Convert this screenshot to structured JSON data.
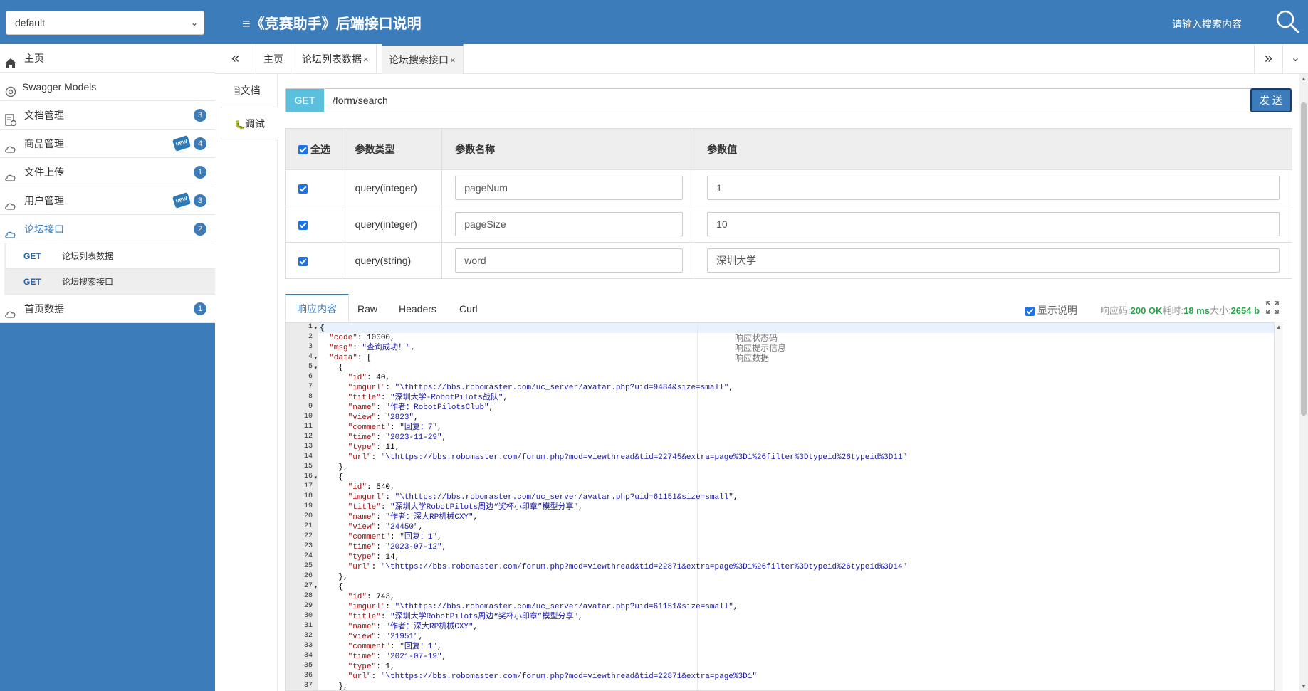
{
  "header": {
    "group_select": "default",
    "title": "≡《竞赛助手》后端接口说明",
    "search_hint": "请输入搜索内容"
  },
  "sidebar": {
    "items": [
      {
        "label": "主页",
        "icon": "home-icon"
      },
      {
        "label": "Swagger Models",
        "icon": "cube-icon"
      },
      {
        "label": "文档管理",
        "icon": "doc-settings-icon",
        "badge": "3"
      },
      {
        "label": "商品管理",
        "icon": "cloud-icon",
        "badge": "4",
        "new": "NEW"
      },
      {
        "label": "文件上传",
        "icon": "cloud-icon",
        "badge": "1"
      },
      {
        "label": "用户管理",
        "icon": "cloud-icon",
        "badge": "3",
        "new": "NEW"
      },
      {
        "label": "论坛接口",
        "icon": "cloud-icon",
        "badge": "2"
      },
      {
        "label": "首页数据",
        "icon": "cloud-icon",
        "badge": "1"
      }
    ],
    "sub_items": [
      {
        "method": "GET",
        "label": "论坛列表数据"
      },
      {
        "method": "GET",
        "label": "论坛搜索接口"
      }
    ]
  },
  "tabs": {
    "items": [
      {
        "label": "主页"
      },
      {
        "label": "论坛列表数据",
        "close": "×"
      },
      {
        "label": "论坛搜索接口",
        "close": "×"
      }
    ],
    "nav_left": "«",
    "nav_right": "»",
    "dropdown": "⌄"
  },
  "vtabs": {
    "doc": "文档",
    "debug": "调试"
  },
  "request": {
    "method": "GET",
    "url": "/form/search",
    "send": "发 送"
  },
  "params": {
    "headers": [
      "全选",
      "参数类型",
      "参数名称",
      "参数值"
    ],
    "rows": [
      {
        "type": "query(integer)",
        "name": "pageNum",
        "value": "1"
      },
      {
        "type": "query(integer)",
        "name": "pageSize",
        "value": "10"
      },
      {
        "type": "query(string)",
        "name": "word",
        "value": "深圳大学"
      }
    ]
  },
  "response": {
    "tabs": [
      "响应内容",
      "Raw",
      "Headers",
      "Curl"
    ],
    "show_desc": "显示说明",
    "status_label": "响应码:",
    "status_code": "200 OK",
    "time_label": "耗时:",
    "time": "18 ms",
    "size_label": "大小:",
    "size": "2654 b"
  },
  "code": {
    "line_numbers": [
      "1",
      "2",
      "3",
      "4",
      "5",
      "6",
      "7",
      "8",
      "9",
      "10",
      "11",
      "12",
      "13",
      "14",
      "15",
      "16",
      "17",
      "18",
      "19",
      "20",
      "21",
      "22",
      "23",
      "24",
      "25",
      "26",
      "27",
      "28",
      "29",
      "30",
      "31",
      "32",
      "33",
      "34",
      "35",
      "36",
      "37"
    ],
    "lines": [
      "{",
      "  \"code\": 10000,",
      "  \"msg\": \"查询成功！\",",
      "  \"data\": [",
      "    {",
      "      \"id\": 40,",
      "      \"imgurl\": \"\\thttps://bbs.robomaster.com/uc_server/avatar.php?uid=9484&size=small\",",
      "      \"title\": \"深圳大学-RobotPilots战队\",",
      "      \"name\": \"作者：RobotPilotsClub\",",
      "      \"view\": \"2823\",",
      "      \"comment\": \"回复：7\",",
      "      \"time\": \"2023-11-29\",",
      "      \"type\": 11,",
      "      \"url\": \"\\thttps://bbs.robomaster.com/forum.php?mod=viewthread&tid=22745&extra=page%3D1%26filter%3Dtypeid%26typeid%3D11\"",
      "    },",
      "    {",
      "      \"id\": 540,",
      "      \"imgurl\": \"\\thttps://bbs.robomaster.com/uc_server/avatar.php?uid=61151&size=small\",",
      "      \"title\": \"深圳大学RobotPilots周边“奖杯小印章”模型分享\",",
      "      \"name\": \"作者：深大RP机械CXY\",",
      "      \"view\": \"24450\",",
      "      \"comment\": \"回复：1\",",
      "      \"time\": \"2023-07-12\",",
      "      \"type\": 14,",
      "      \"url\": \"\\thttps://bbs.robomaster.com/forum.php?mod=viewthread&tid=22871&extra=page%3D1%26filter%3Dtypeid%26typeid%3D14\"",
      "    },",
      "    {",
      "      \"id\": 743,",
      "      \"imgurl\": \"\\thttps://bbs.robomaster.com/uc_server/avatar.php?uid=61151&size=small\",",
      "      \"title\": \"深圳大学RobotPilots周边“奖杯小印章”模型分享\",",
      "      \"name\": \"作者：深大RP机械CXY\",",
      "      \"view\": \"21951\",",
      "      \"comment\": \"回复：1\",",
      "      \"time\": \"2021-07-19\",",
      "      \"type\": 1,",
      "      \"url\": \"\\thttps://bbs.robomaster.com/forum.php?mod=viewthread&tid=22871&extra=page%3D1\"",
      "    },"
    ],
    "comments": [
      "响应状态码",
      "响应提示信息",
      "响应数据"
    ]
  },
  "colors": {
    "brand": "#3c7cba",
    "method_get": "#5bc0de",
    "status_ok": "#2ba24c"
  }
}
